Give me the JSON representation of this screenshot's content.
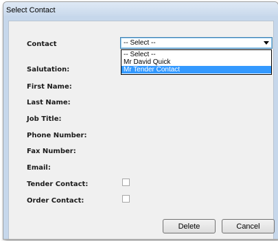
{
  "window": {
    "title": "Select Contact"
  },
  "form": {
    "contact_label": "Contact",
    "contact_select": {
      "value": "-- Select --",
      "options": [
        "-- Select --",
        "Mr David Quick",
        "Mr Tender Contact"
      ],
      "highlighted_index": 2
    },
    "labels": {
      "salutation": "Salutation:",
      "first_name": "First Name:",
      "last_name": "Last Name:",
      "job_title": "Job Title:",
      "phone_number": "Phone Number:",
      "fax_number": "Fax Number:",
      "email": "Email:",
      "tender_contact": "Tender Contact:",
      "order_contact": "Order Contact:"
    },
    "checkboxes": {
      "tender_contact_checked": false,
      "order_contact_checked": false
    }
  },
  "buttons": {
    "delete_label": "Delete",
    "cancel_label": "Cancel"
  },
  "icons": {
    "dropdown_arrow": "chevron-down-icon"
  }
}
